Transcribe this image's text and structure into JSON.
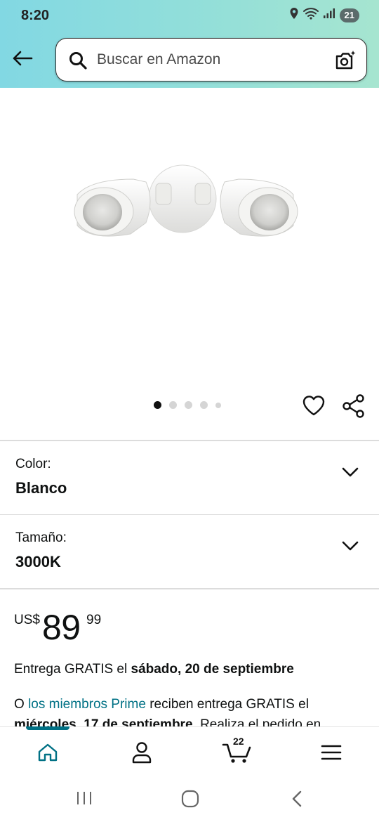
{
  "status_bar": {
    "time": "8:20",
    "battery": "21"
  },
  "search": {
    "placeholder": "Buscar en Amazon"
  },
  "gallery": {
    "image_count": 5,
    "active_index": 0
  },
  "variations": [
    {
      "label": "Color:",
      "value": "Blanco"
    },
    {
      "label": "Tamaño:",
      "value": "3000K"
    }
  ],
  "price": {
    "currency": "US$",
    "whole": "89",
    "fraction": "99"
  },
  "delivery": {
    "prefix": "Entrega GRATIS el ",
    "date": "sábado, 20 de septiembre"
  },
  "prime": {
    "prefix": "O ",
    "link": "los miembros Prime",
    "middle": " reciben entrega GRATIS el ",
    "date": "miércoles, 17 de septiembre",
    "suffix": ". Realiza el pedido en"
  },
  "bottom_nav": {
    "cart_count": "22"
  },
  "colors": {
    "accent": "#007185",
    "header_start": "#82d8e3",
    "header_end": "#a6e5d0"
  }
}
